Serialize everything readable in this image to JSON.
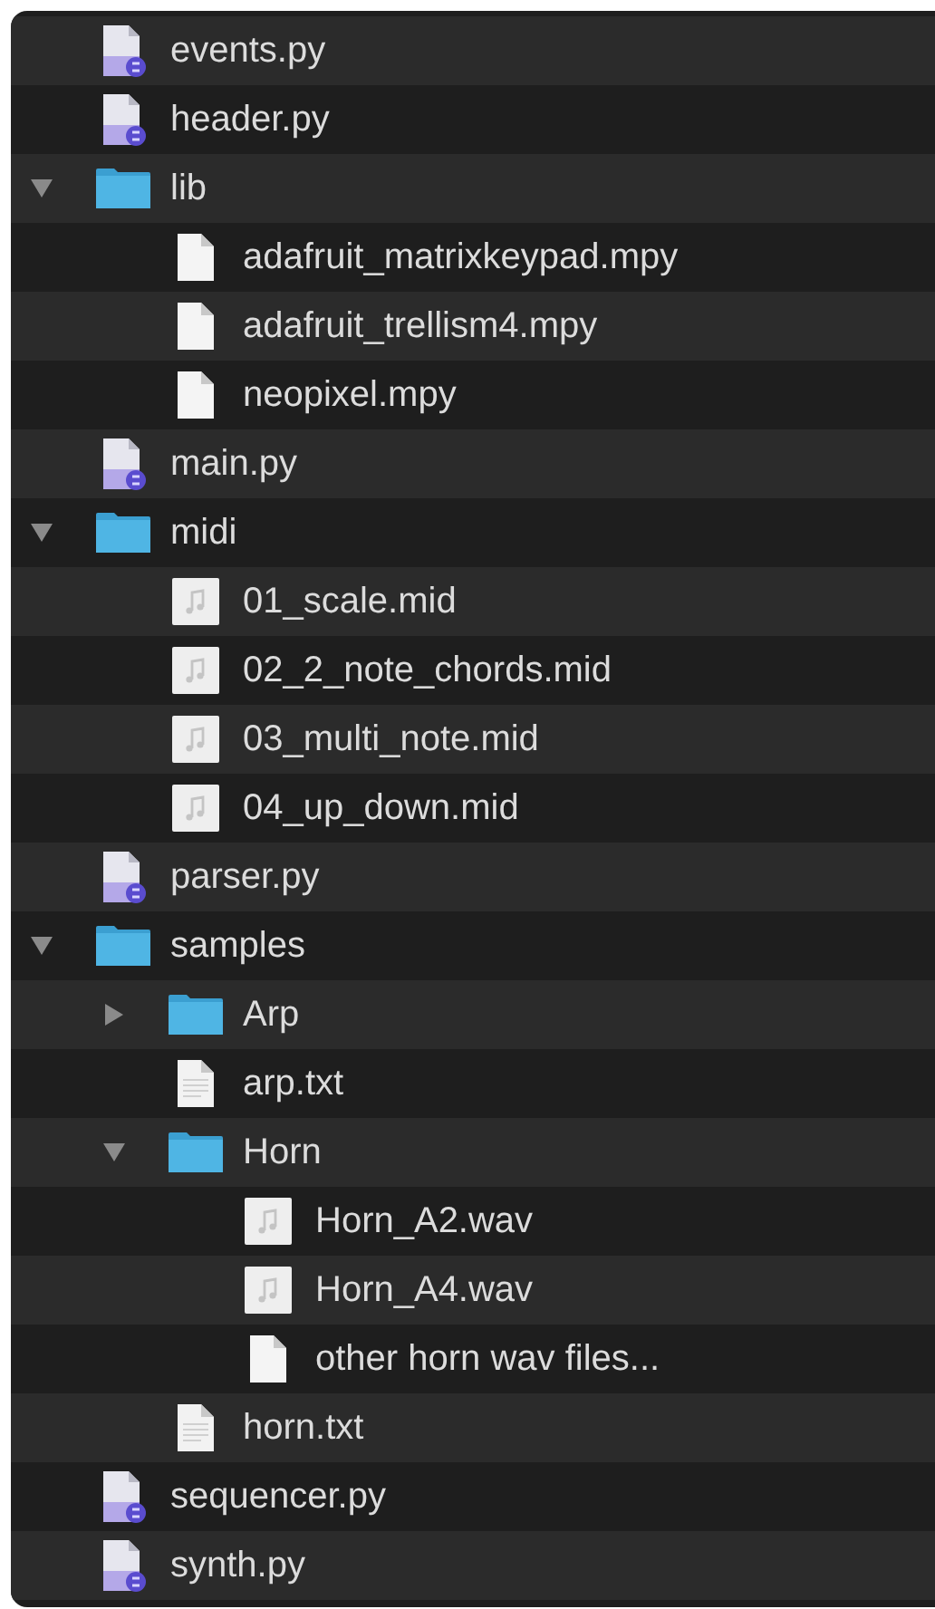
{
  "files": [
    {
      "name": "events.py",
      "kind": "python"
    },
    {
      "name": "header.py",
      "kind": "python"
    },
    {
      "name": "lib",
      "kind": "folder",
      "expanded": true,
      "children": [
        {
          "name": "adafruit_matrixkeypad.mpy",
          "kind": "document"
        },
        {
          "name": "adafruit_trellism4.mpy",
          "kind": "document"
        },
        {
          "name": "neopixel.mpy",
          "kind": "document"
        }
      ]
    },
    {
      "name": "main.py",
      "kind": "python"
    },
    {
      "name": "midi",
      "kind": "folder",
      "expanded": true,
      "children": [
        {
          "name": "01_scale.mid",
          "kind": "audio"
        },
        {
          "name": "02_2_note_chords.mid",
          "kind": "audio"
        },
        {
          "name": "03_multi_note.mid",
          "kind": "audio"
        },
        {
          "name": "04_up_down.mid",
          "kind": "audio"
        }
      ]
    },
    {
      "name": "parser.py",
      "kind": "python"
    },
    {
      "name": "samples",
      "kind": "folder",
      "expanded": true,
      "children": [
        {
          "name": "Arp",
          "kind": "folder",
          "expanded": false
        },
        {
          "name": "arp.txt",
          "kind": "text"
        },
        {
          "name": "Horn",
          "kind": "folder",
          "expanded": true,
          "children": [
            {
              "name": "Horn_A2.wav",
              "kind": "audio"
            },
            {
              "name": "Horn_A4.wav",
              "kind": "audio"
            },
            {
              "name": "other horn wav files...",
              "kind": "document"
            }
          ]
        },
        {
          "name": "horn.txt",
          "kind": "text"
        }
      ]
    },
    {
      "name": "sequencer.py",
      "kind": "python"
    },
    {
      "name": "synth.py",
      "kind": "python"
    }
  ]
}
